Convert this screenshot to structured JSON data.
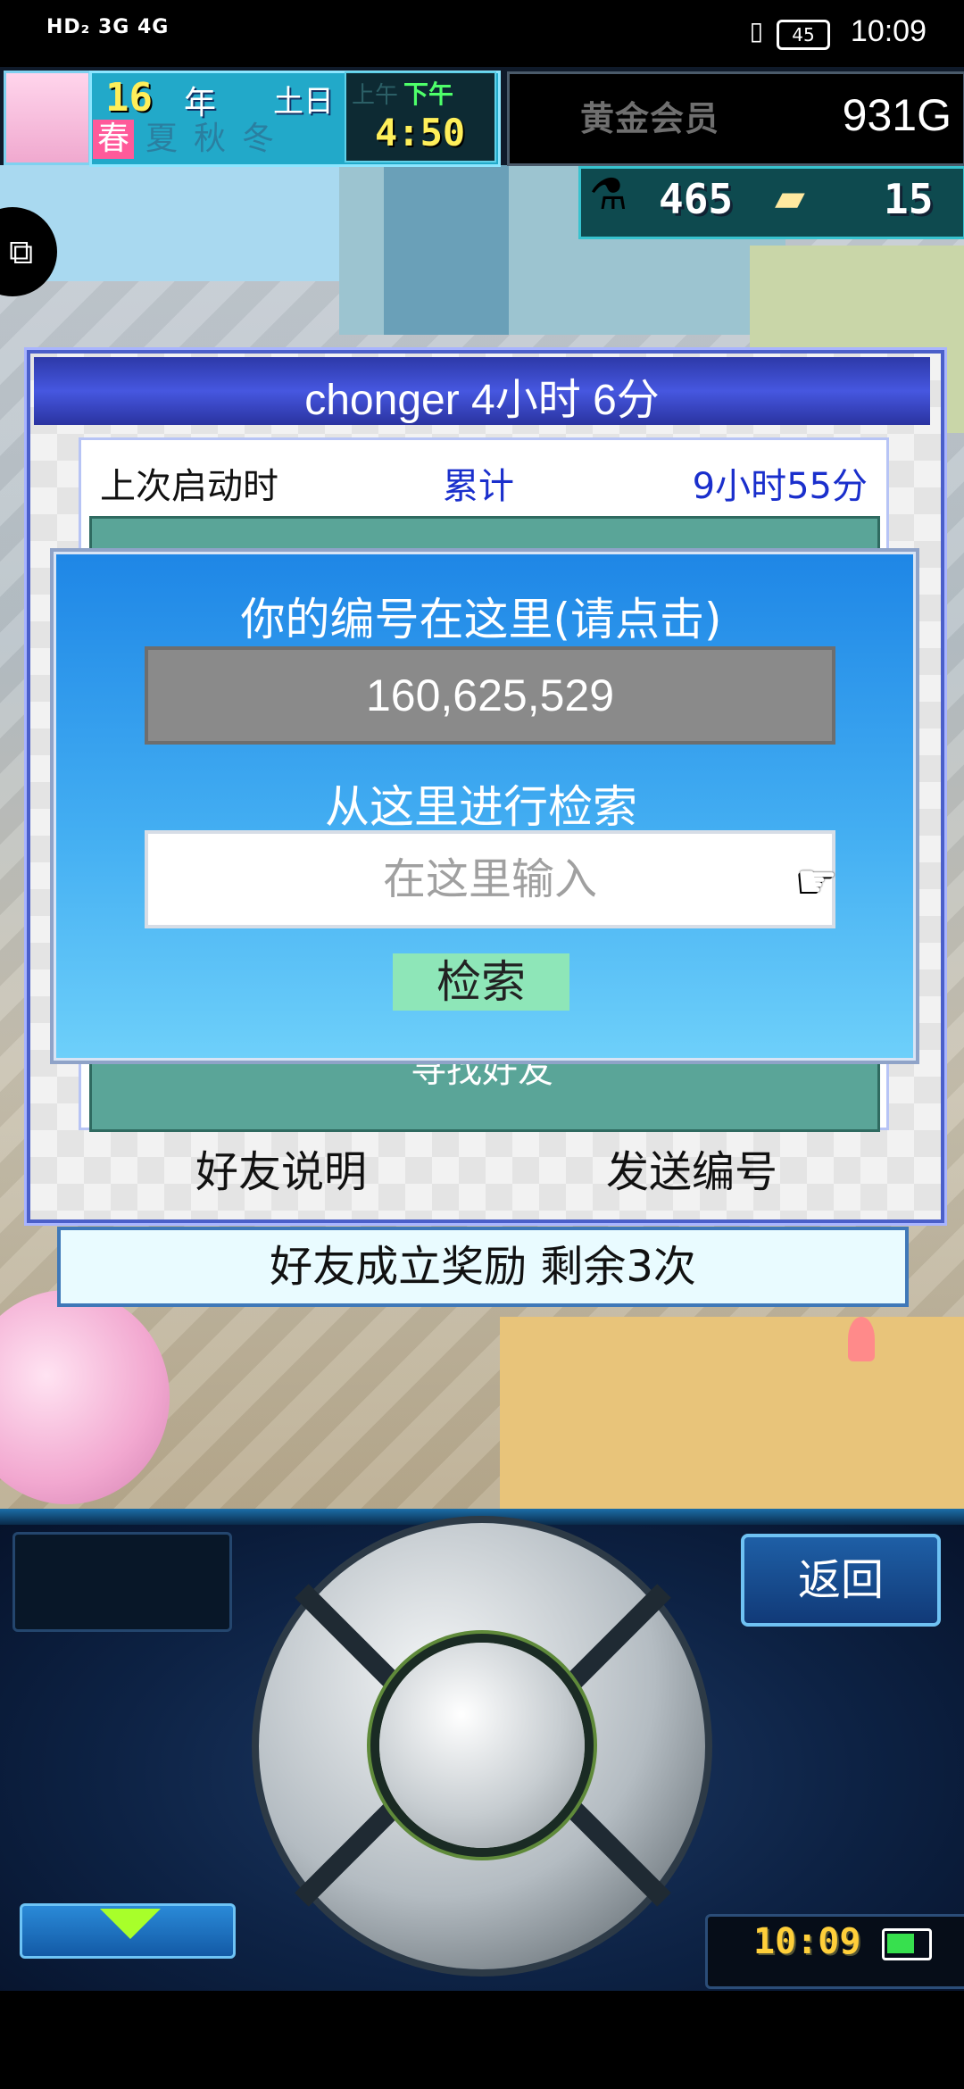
{
  "status_bar": {
    "network": "HD₂ 3G 4G",
    "battery": "45",
    "time": "10:09"
  },
  "hud": {
    "year": "16",
    "year_label": "年",
    "weekday": "土日",
    "seasons": [
      "春",
      "夏",
      "秋",
      "冬"
    ],
    "am": "上午",
    "pm": "下午",
    "clock": "4:50",
    "member": "黄金会员",
    "gold": "931G",
    "resource_1": "465",
    "resource_2": "15"
  },
  "panel": {
    "title": "chonger  4小时 6分",
    "last_launch_label": "上次启动时",
    "total_label": "累计",
    "total_value": "9小时55分",
    "find_friend": "寻找好友",
    "help_button": "好友说明",
    "send_button": "发送编号",
    "reward": "好友成立奖励  剩余3次"
  },
  "modal": {
    "title": "你的编号在这里(请点击)",
    "id_number": "160,625,529",
    "search_label": "从这里进行检索",
    "search_placeholder": "在这里输入",
    "search_button": "检索"
  },
  "controller": {
    "back_button": "返回",
    "clock": "10:09"
  },
  "icons": [
    "vibrate-icon",
    "battery-icon",
    "puzzle-icon",
    "flask-icon",
    "ticket-icon",
    "pointer-hand-icon",
    "down-arrow-icon",
    "dpad-icon"
  ]
}
